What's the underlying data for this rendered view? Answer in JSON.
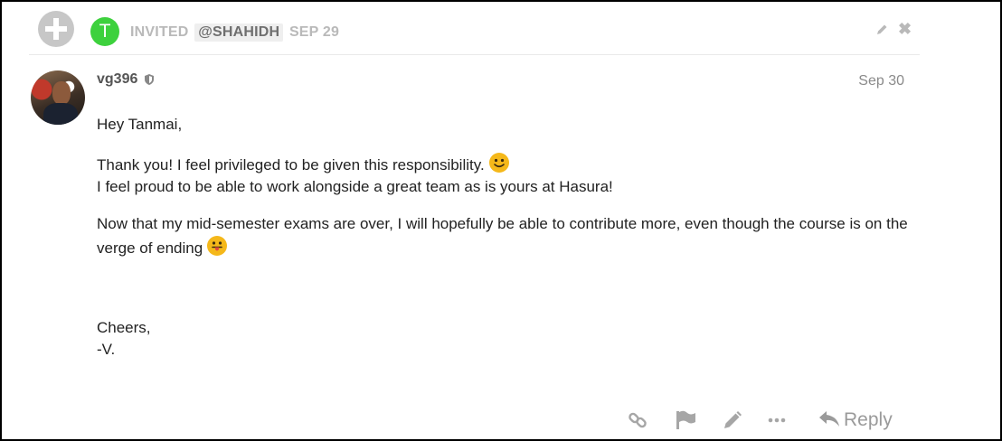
{
  "action_row": {
    "invitee_initial": "T",
    "label": "INVITED",
    "mention": "@SHAHIDH",
    "date": "SEP 29"
  },
  "post": {
    "username": "vg396",
    "date": "Sep 30",
    "paragraphs": {
      "greeting": "Hey Tanmai,",
      "thanks": "Thank you! I feel privileged to be given this responsibility.",
      "thanks2": "I feel proud to be able to work alongside a great team as is yours at Hasura!",
      "now": "Now that my mid-semester exams are over, I will hopefully be able to contribute more, even though the course is on the verge of ending",
      "cheers": "Cheers,",
      "sign": "-V."
    }
  },
  "controls": {
    "reply_label": "Reply"
  },
  "icons": [
    "plus-icon",
    "pencil-icon",
    "close-icon",
    "shield-icon",
    "smile-emoji-icon",
    "tongue-emoji-icon",
    "link-icon",
    "flag-icon",
    "more-icon",
    "reply-icon"
  ],
  "colors": {
    "invitee_avatar": "#3dd13d",
    "muted_text": "#b9b9b9",
    "body_text": "#222222"
  }
}
